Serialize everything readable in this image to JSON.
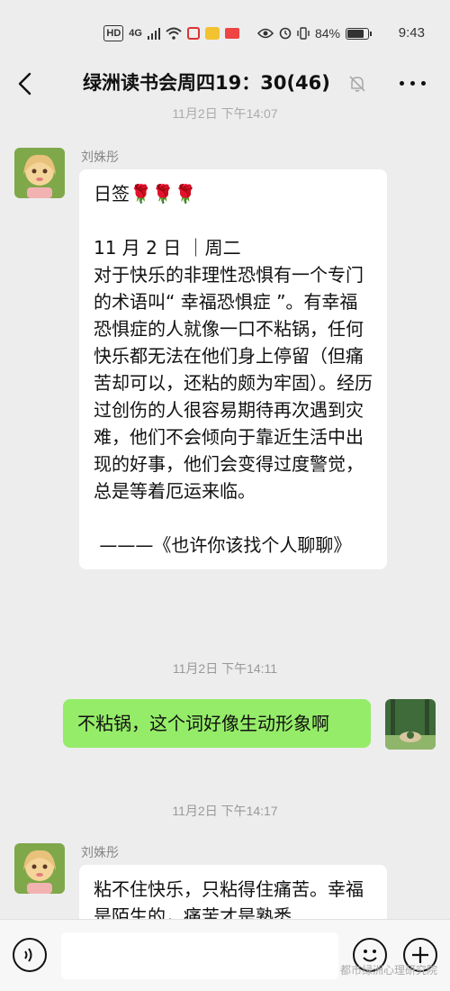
{
  "status_bar": {
    "hd_label": "HD",
    "signal_label": "4G",
    "battery_percent": "84%",
    "battery_level": 0.84,
    "time": "9:43"
  },
  "header": {
    "title": "绿洲读书会周四19：30(46)",
    "icons": {
      "back": "back-arrow-icon",
      "mute": "bell-muted-icon",
      "more": "more-dots-icon"
    }
  },
  "chat": {
    "top_timestamp": "11月2日 下午14:07",
    "messages": [
      {
        "sender": "刘姝彤",
        "side": "left",
        "text": "日签🌹🌹🌹\n\n11 月 2 日 ｜周二\n对于快乐的非理性恐惧有一个专门的术语叫“ 幸福恐惧症 ”。有幸福恐惧症的人就像一口不粘锅，任何快乐都无法在他们身上停留（但痛苦却可以，还粘的颇为牢固）。经历过创伤的人很容易期待再次遇到灾难，他们不会倾向于靠近生活中出现的好事，他们会变得过度警觉，总是等着厄运来临。\n\n ———《也许你该找个人聊聊》"
      },
      {
        "timestamp": "11月2日 下午14:11",
        "side": "right",
        "text": "不粘锅，这个词好像生动形象啊"
      },
      {
        "timestamp": "11月2日 下午14:17",
        "sender": "刘姝彤",
        "side": "left",
        "text": "粘不住快乐，只粘得住痛苦。幸福是陌生的，痛苦才是熟悉"
      }
    ]
  },
  "input_bar": {
    "placeholder": "",
    "icons": {
      "voice": "voice-icon",
      "emoji": "emoji-icon",
      "plus": "plus-icon"
    }
  },
  "watermark": "都市绿洲心理研究院",
  "colors": {
    "background": "#ededed",
    "my_bubble": "#95ec69",
    "other_bubble": "#ffffff"
  }
}
